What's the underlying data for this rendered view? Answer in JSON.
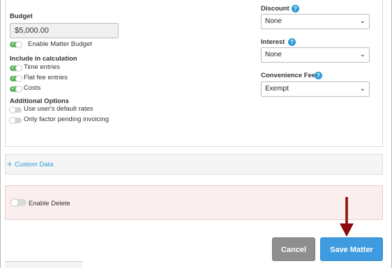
{
  "budget": {
    "label": "Budget",
    "value": "$5,000.00",
    "enable_label": "Enable Matter Budget",
    "enabled": true
  },
  "calculation": {
    "heading": "Include in calculation",
    "items": [
      {
        "label": "Time entries",
        "enabled": true
      },
      {
        "label": "Flat fee entries",
        "enabled": true
      },
      {
        "label": "Costs",
        "enabled": true
      }
    ]
  },
  "additional": {
    "heading": "Additional Options",
    "items": [
      {
        "label": "Use user's default rates",
        "enabled": false
      },
      {
        "label": "Only factor pending invoicing",
        "enabled": false
      }
    ]
  },
  "discount": {
    "label": "Discount",
    "help": "?",
    "value": "None"
  },
  "interest": {
    "label": "Interest",
    "help": "?",
    "value": "None"
  },
  "convenience_fee": {
    "label": "Convenience Fee",
    "help": "?",
    "value": "Exempt"
  },
  "custom_data": {
    "plus": "+",
    "label": "Custom Data"
  },
  "enable_delete": {
    "label": "Enable Delete",
    "enabled": false
  },
  "buttons": {
    "cancel": "Cancel",
    "save": "Save Matter"
  },
  "colors": {
    "accent": "#3e9be0",
    "toggle_on": "#5cb85c",
    "cancel": "#8e8e8e",
    "danger_bg": "#fbeeee",
    "annotation_arrow": "#8b0a0a"
  },
  "icons": {
    "chevron": "chevron-down-icon",
    "help": "help-circle-icon",
    "plus": "plus-icon",
    "check": "check-icon"
  }
}
